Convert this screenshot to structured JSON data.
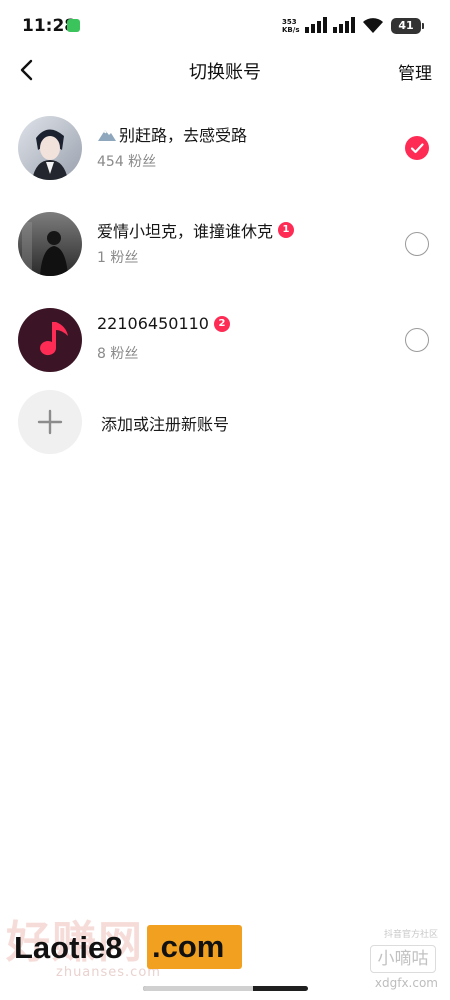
{
  "status_bar": {
    "time": "11:28",
    "net_speed_value": "353",
    "net_speed_unit": "KB/s",
    "battery": "41"
  },
  "header": {
    "title": "切换账号",
    "manage_label": "管理"
  },
  "accounts": [
    {
      "name": "别赶路，去感受路",
      "has_emoji": "mountain",
      "fans": "454 粉丝",
      "selected": true,
      "badge": ""
    },
    {
      "name": "爱情小坦克，谁撞谁休克",
      "fans": "1 粉丝",
      "selected": false,
      "badge": "1"
    },
    {
      "name": "22106450110",
      "fans": "8 粉丝",
      "selected": false,
      "badge": "2"
    }
  ],
  "add_account_label": "添加或注册新账号",
  "watermark": {
    "main": "Laotie8",
    "suffix": ".com",
    "faint": "好赚网",
    "faint_sub": "zhuanses.com",
    "right_top": "抖音官方社区",
    "right_mid": "小嘀咕",
    "right_bottom": "xdgfx.com"
  },
  "colors": {
    "accent": "#fe2c55",
    "watermark_orange": "#f2a01f",
    "muted_text": "#8a8a8a"
  }
}
